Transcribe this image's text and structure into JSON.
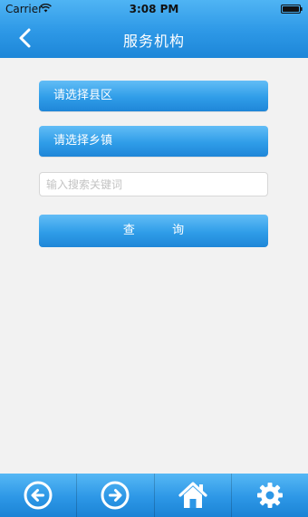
{
  "status_bar": {
    "carrier": "Carrier",
    "time": "3:08 PM",
    "wifi_icon": "wifi-icon",
    "battery_icon": "battery-icon"
  },
  "nav": {
    "title": "服务机构",
    "back_icon": "chevron-left-icon"
  },
  "form": {
    "county_select_label": "请选择县区",
    "town_select_label": "请选择乡镇",
    "search_placeholder": "输入搜索关键词",
    "search_value": "",
    "query_button_label": "查          询"
  },
  "tab_bar": {
    "items": [
      {
        "name": "back",
        "icon": "arrow-left-circle-icon"
      },
      {
        "name": "forward",
        "icon": "arrow-right-circle-icon"
      },
      {
        "name": "home",
        "icon": "home-icon"
      },
      {
        "name": "settings",
        "icon": "gear-icon"
      }
    ]
  },
  "colors": {
    "primary_blue": "#2d98e6",
    "background": "#f2f2f2",
    "input_border": "#d7d7d7"
  }
}
